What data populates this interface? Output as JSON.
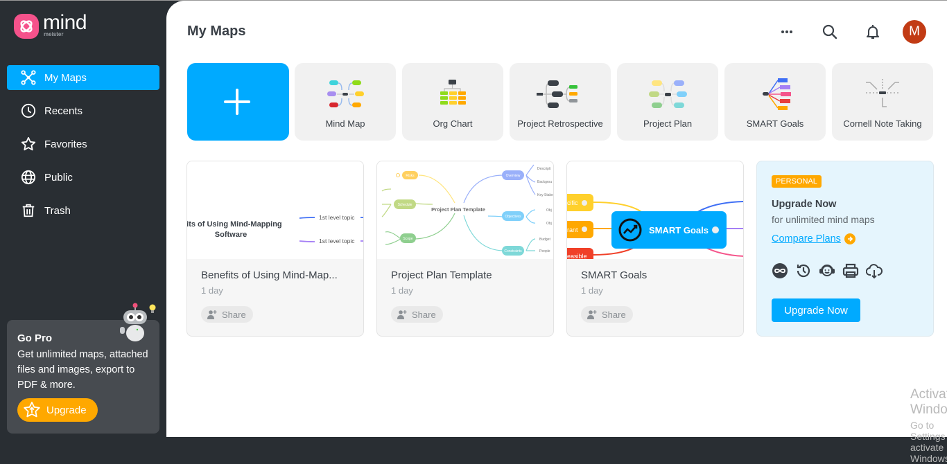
{
  "app": {
    "logo_word": "mind",
    "logo_sub": "meister"
  },
  "sidebar": {
    "items": [
      {
        "label": "My Maps",
        "icon": "mindmap-icon",
        "active": true
      },
      {
        "label": "Recents",
        "icon": "clock-icon"
      },
      {
        "label": "Favorites",
        "icon": "star-icon"
      },
      {
        "label": "Public",
        "icon": "globe-icon"
      },
      {
        "label": "Trash",
        "icon": "trash-icon"
      }
    ],
    "gopro": {
      "title": "Go Pro",
      "text": "Get unlimited maps, attached files and images, export to PDF & more.",
      "button": "Upgrade"
    }
  },
  "header": {
    "title": "My Maps",
    "icons": [
      "more-icon",
      "search-icon",
      "bell-icon"
    ],
    "avatar_initial": "M",
    "avatar_color": "#c23b14"
  },
  "templates": [
    {
      "label": "Mind Map"
    },
    {
      "label": "Org Chart"
    },
    {
      "label": "Project Retrospective"
    },
    {
      "label": "Project Plan"
    },
    {
      "label": "SMART Goals"
    },
    {
      "label": "Cornell Note Taking"
    }
  ],
  "maps": [
    {
      "title": "Benefits of Using Mind-Map...",
      "time": "1 day",
      "share": "Share",
      "preview": {
        "center_line1": "efits of Using Mind-Mapping",
        "center_line2": "Software",
        "topics": [
          "1st level topic",
          "1st level topic"
        ]
      }
    },
    {
      "title": "Project Plan Template",
      "time": "1 day",
      "share": "Share",
      "preview": {
        "center": "Project Plan Template",
        "left": [
          "Risks",
          "Schedule",
          "Scope"
        ],
        "right": [
          "Overview",
          "Objectives",
          "Constraints"
        ],
        "leaves": [
          "Descripti",
          "Backgrou",
          "Key Stake",
          "Obj",
          "Obj",
          "Budget",
          "People"
        ]
      }
    },
    {
      "title": "SMART Goals",
      "time": "1 day",
      "share": "Share",
      "preview": {
        "center": "SMART Goals",
        "left": [
          "cific",
          "rant",
          "easible"
        ]
      }
    }
  ],
  "promo": {
    "badge": "PERSONAL",
    "title": "Upgrade Now",
    "subtitle": "for unlimited mind maps",
    "link": "Compare Plans",
    "button": "Upgrade Now",
    "feature_icons": [
      "infinity-icon",
      "history-icon",
      "support-icon",
      "print-icon",
      "cloud-download-icon"
    ]
  },
  "colors": {
    "accent": "#00aaff",
    "sidebar_bg": "#292e33",
    "brand_pink": "#f5528b",
    "orange": "#ffa800"
  },
  "watermark": {
    "line1": "Activate Windows",
    "line2": "Go to Settings to activate Windows."
  }
}
